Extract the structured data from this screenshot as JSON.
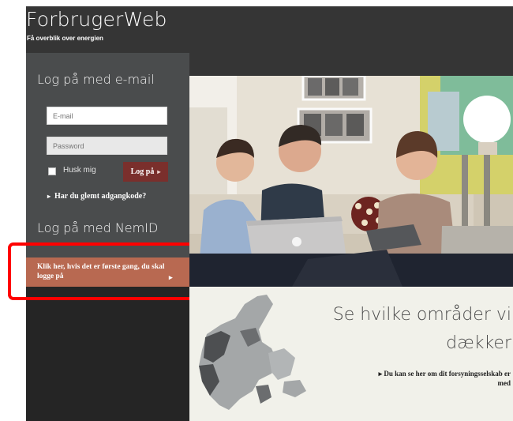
{
  "header": {
    "title": "ForbrugerWeb",
    "tagline": "Få overblik over energien"
  },
  "email_login": {
    "title": "Log på med e-mail",
    "email_placeholder": "E-mail",
    "password_placeholder": "Password",
    "remember_label": "Husk mig",
    "login_button": "Log på",
    "forgot_link": "Har du glemt adgangkode?"
  },
  "nemid_login": {
    "title": "Log på med NemID",
    "first_time_button": "Klik her, hvis det er første gang, du skal logge på"
  },
  "info": {
    "heading_line1": "Se hvilke områder vi",
    "heading_line2": "dækker",
    "link_text": "Du kan se her om dit forsyningsselskab er med"
  },
  "colors": {
    "header_bg": "#353535",
    "panel_bg": "#4a4c4d",
    "login_button": "#7a2f2c",
    "nemid_button": "#b86951",
    "highlight_border": "#ff0000"
  },
  "icons": [
    "arrow-right-icon",
    "triangle-right-icon"
  ]
}
